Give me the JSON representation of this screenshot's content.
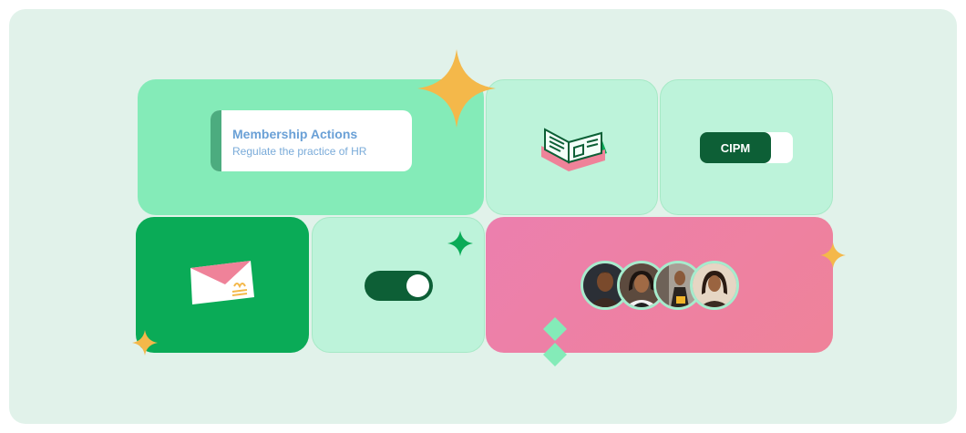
{
  "membership": {
    "title": "Membership Actions",
    "subtitle": "Regulate the practice of HR"
  },
  "cipm": {
    "label": "CIPM"
  },
  "toggle": {
    "state": "on"
  },
  "avatars": [
    {
      "name": "avatar-1"
    },
    {
      "name": "avatar-2"
    },
    {
      "name": "avatar-3"
    },
    {
      "name": "avatar-4"
    }
  ],
  "colors": {
    "frame_bg": "#e1f2ea",
    "mint": "#84ebb8",
    "pale_mint": "#bdf3da",
    "green": "#0aab57",
    "dark_green": "#0d5f36",
    "pink": "#ec7fae",
    "accent_yellow": "#f4b84a",
    "label_blue": "#6aa0d6"
  },
  "icons": [
    "sparkle-icon",
    "book-icon",
    "envelope-icon",
    "toggle-switch",
    "diamond-icon"
  ]
}
